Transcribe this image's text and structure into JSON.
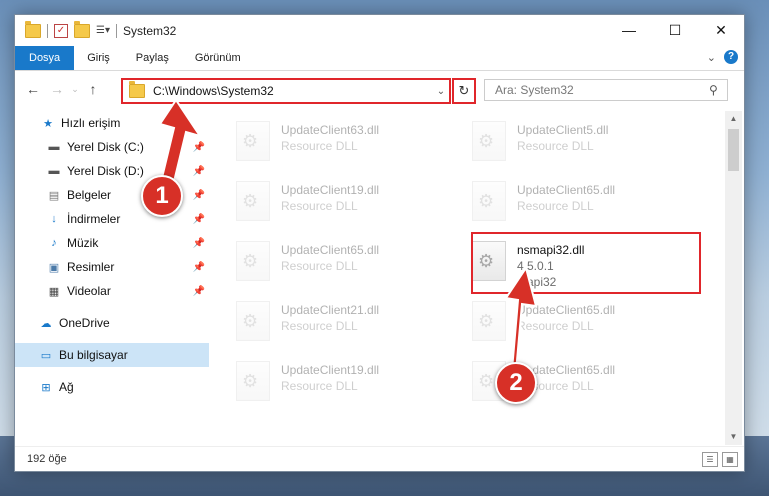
{
  "window": {
    "title": "System32",
    "controls": {
      "minimize": "—",
      "maximize": "☐",
      "close": "✕"
    }
  },
  "ribbon": {
    "tabs": [
      "Dosya",
      "Giriş",
      "Paylaş",
      "Görünüm"
    ],
    "active_tab": "Dosya"
  },
  "address": {
    "path": "C:\\Windows\\System32"
  },
  "search": {
    "placeholder": "Ara: System32"
  },
  "nav": {
    "items": [
      {
        "label": "Hızlı erişim",
        "icon": "star-icon",
        "pinned": false
      },
      {
        "label": "Yerel Disk (C:)",
        "icon": "drive-icon",
        "pinned": true
      },
      {
        "label": "Yerel Disk (D:)",
        "icon": "drive-icon",
        "pinned": true
      },
      {
        "label": "Belgeler",
        "icon": "document-icon",
        "pinned": true
      },
      {
        "label": "İndirmeler",
        "icon": "download-icon",
        "pinned": true
      },
      {
        "label": "Müzik",
        "icon": "music-icon",
        "pinned": true
      },
      {
        "label": "Resimler",
        "icon": "pictures-icon",
        "pinned": true
      },
      {
        "label": "Videolar",
        "icon": "video-icon",
        "pinned": true
      },
      {
        "label": "OneDrive",
        "icon": "cloud-icon",
        "pinned": false
      },
      {
        "label": "Bu bilgisayar",
        "icon": "computer-icon",
        "pinned": false,
        "selected": true
      },
      {
        "label": "Ağ",
        "icon": "network-icon",
        "pinned": false
      }
    ]
  },
  "files": [
    {
      "name": "UpdateClient63.dll",
      "sub": "Resource DLL",
      "ghost": true
    },
    {
      "name": "UpdateClient5.dll",
      "sub": "Resource DLL",
      "ghost": true
    },
    {
      "name": "UpdateClient19.dll",
      "sub": "Resource DLL",
      "ghost": true
    },
    {
      "name": "UpdateClient65.dll",
      "sub": "Resource DLL",
      "ghost": true
    },
    {
      "name": "UpdateClient65.dll",
      "sub": "Resource DLL",
      "ghost": true
    },
    {
      "name": "nsmapi32.dll",
      "sub": "4.5.0.1",
      "sub2": "mapi32",
      "ghost": false,
      "highlighted": true
    },
    {
      "name": "UpdateClient21.dll",
      "sub": "Resource DLL",
      "ghost": true
    },
    {
      "name": "UpdateClient65.dll",
      "sub": "Resource DLL",
      "ghost": true
    },
    {
      "name": "UpdateClient19.dll",
      "sub": "Resource DLL",
      "ghost": true
    },
    {
      "name": "UpdateClient65.dll",
      "sub": "Resource DLL",
      "ghost": true
    }
  ],
  "status": {
    "count": "192 öğe"
  },
  "callouts": [
    "1",
    "2"
  ],
  "colors": {
    "accent": "#1979ca",
    "highlight": "#e0262b",
    "callout": "#d73027"
  }
}
